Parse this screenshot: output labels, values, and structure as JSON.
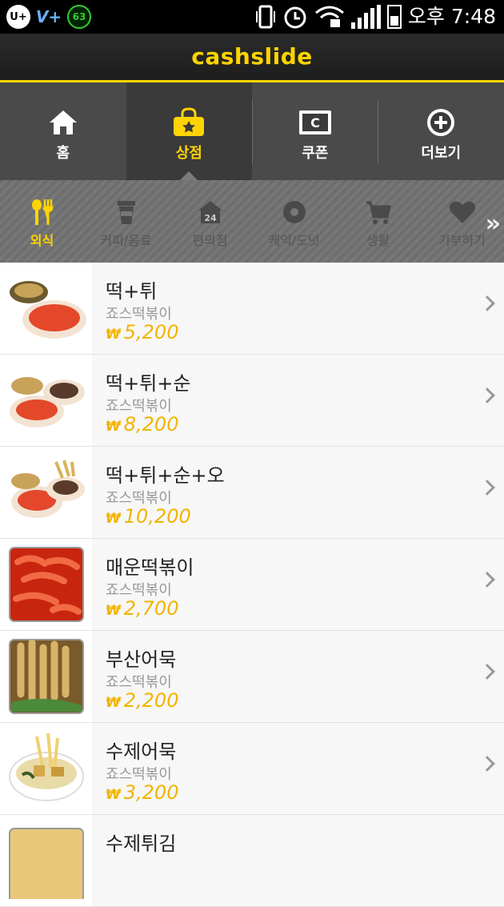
{
  "status_bar": {
    "icons": [
      "u-plus-icon",
      "v-plus-icon",
      "badge-63-icon"
    ],
    "badge_text": "63",
    "u_text": "U+",
    "v_text": "V+",
    "right_icons": [
      "vibrate-icon",
      "alarm-icon",
      "wifi-lock-icon",
      "signal-icon",
      "battery-icon"
    ],
    "time": "오후 7:48"
  },
  "header": {
    "title": "cashslide"
  },
  "tabs": [
    {
      "label": "홈",
      "icon": "home-icon"
    },
    {
      "label": "상점",
      "icon": "shopping-bag-icon",
      "active": true
    },
    {
      "label": "쿠폰",
      "icon": "coupon-icon"
    },
    {
      "label": "더보기",
      "icon": "plus-circle-icon"
    }
  ],
  "categories": [
    {
      "label": "외식",
      "icon": "fork-spoon-icon",
      "active": true
    },
    {
      "label": "커피/음료",
      "icon": "cup-icon"
    },
    {
      "label": "편의점",
      "icon": "store-24-icon",
      "badge": "24"
    },
    {
      "label": "케익/도넛",
      "icon": "donut-icon"
    },
    {
      "label": "생활",
      "icon": "cart-icon"
    },
    {
      "label": "기부하기",
      "icon": "heart-icon"
    }
  ],
  "more_arrow": "»",
  "items": [
    {
      "name": "떡+튀",
      "brand": "죠스떡볶이",
      "currency": "₩",
      "price": "5,200"
    },
    {
      "name": "떡+튀+순",
      "brand": "죠스떡볶이",
      "currency": "₩",
      "price": "8,200"
    },
    {
      "name": "떡+튀+순+오",
      "brand": "죠스떡볶이",
      "currency": "₩",
      "price": "10,200"
    },
    {
      "name": "매운떡볶이",
      "brand": "죠스떡볶이",
      "currency": "₩",
      "price": "2,700"
    },
    {
      "name": "부산어묵",
      "brand": "죠스떡볶이",
      "currency": "₩",
      "price": "2,200"
    },
    {
      "name": "수제어묵",
      "brand": "죠스떡볶이",
      "currency": "₩",
      "price": "3,200"
    },
    {
      "name": "수제튀김",
      "brand": "",
      "currency": "",
      "price": ""
    }
  ],
  "colors": {
    "accent": "#ffd400",
    "price": "#f2b400",
    "tab_bg": "#4a4a4a"
  }
}
